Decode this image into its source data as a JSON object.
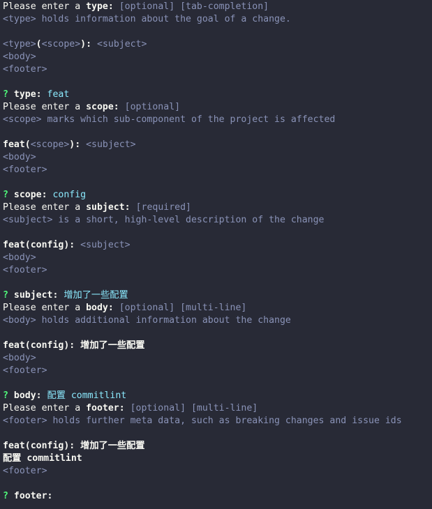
{
  "theme": {
    "background": "#282a36",
    "text": "#f8f8f2",
    "dim": "#8a93b8",
    "answer": "#8be9fd",
    "prompt_mark": "#50fa7b"
  },
  "lines": [
    [
      {
        "s": "w",
        "t": "Please enter a "
      },
      {
        "s": "b",
        "t": "type:"
      },
      {
        "s": "d",
        "t": " [optional] [tab-completion]"
      }
    ],
    [
      {
        "s": "d",
        "t": "<type> holds information about the goal of a change."
      }
    ],
    [],
    [
      {
        "s": "d",
        "t": "<type>"
      },
      {
        "s": "b",
        "t": "("
      },
      {
        "s": "d",
        "t": "<scope>"
      },
      {
        "s": "b",
        "t": "):"
      },
      {
        "s": "d",
        "t": " <subject>"
      }
    ],
    [
      {
        "s": "d",
        "t": "<body>"
      }
    ],
    [
      {
        "s": "d",
        "t": "<footer>"
      }
    ],
    [],
    [
      {
        "s": "g",
        "t": "?"
      },
      {
        "s": "b",
        "t": " type:"
      },
      {
        "s": "c",
        "t": " feat"
      }
    ],
    [
      {
        "s": "w",
        "t": "Please enter a "
      },
      {
        "s": "b",
        "t": "scope:"
      },
      {
        "s": "d",
        "t": " [optional]"
      }
    ],
    [
      {
        "s": "d",
        "t": "<scope> marks which sub-component of the project is affected"
      }
    ],
    [],
    [
      {
        "s": "b",
        "t": "feat("
      },
      {
        "s": "d",
        "t": "<scope>"
      },
      {
        "s": "b",
        "t": "):"
      },
      {
        "s": "d",
        "t": " <subject>"
      }
    ],
    [
      {
        "s": "d",
        "t": "<body>"
      }
    ],
    [
      {
        "s": "d",
        "t": "<footer>"
      }
    ],
    [],
    [
      {
        "s": "g",
        "t": "?"
      },
      {
        "s": "b",
        "t": " scope:"
      },
      {
        "s": "c",
        "t": " config"
      }
    ],
    [
      {
        "s": "w",
        "t": "Please enter a "
      },
      {
        "s": "b",
        "t": "subject:"
      },
      {
        "s": "d",
        "t": " [required]"
      }
    ],
    [
      {
        "s": "d",
        "t": "<subject> is a short, high-level description of the change"
      }
    ],
    [],
    [
      {
        "s": "b",
        "t": "feat(config):"
      },
      {
        "s": "d",
        "t": " <subject>"
      }
    ],
    [
      {
        "s": "d",
        "t": "<body>"
      }
    ],
    [
      {
        "s": "d",
        "t": "<footer>"
      }
    ],
    [],
    [
      {
        "s": "g",
        "t": "?"
      },
      {
        "s": "b",
        "t": " subject:"
      },
      {
        "s": "c",
        "t": " 增加了一些配置"
      }
    ],
    [
      {
        "s": "w",
        "t": "Please enter a "
      },
      {
        "s": "b",
        "t": "body:"
      },
      {
        "s": "d",
        "t": " [optional] [multi-line]"
      }
    ],
    [
      {
        "s": "d",
        "t": "<body> holds additional information about the change"
      }
    ],
    [],
    [
      {
        "s": "b",
        "t": "feat(config): 增加了一些配置"
      }
    ],
    [
      {
        "s": "d",
        "t": "<body>"
      }
    ],
    [
      {
        "s": "d",
        "t": "<footer>"
      }
    ],
    [],
    [
      {
        "s": "g",
        "t": "?"
      },
      {
        "s": "b",
        "t": " body:"
      },
      {
        "s": "c",
        "t": " 配置 commitlint"
      }
    ],
    [
      {
        "s": "w",
        "t": "Please enter a "
      },
      {
        "s": "b",
        "t": "footer:"
      },
      {
        "s": "d",
        "t": " [optional] [multi-line]"
      }
    ],
    [
      {
        "s": "d",
        "t": "<footer> holds further meta data, such as breaking changes and issue ids"
      }
    ],
    [],
    [
      {
        "s": "b",
        "t": "feat(config): 增加了一些配置"
      }
    ],
    [
      {
        "s": "b",
        "t": "配置 commitlint"
      }
    ],
    [
      {
        "s": "d",
        "t": "<footer>"
      }
    ],
    [],
    [
      {
        "s": "g",
        "t": "?"
      },
      {
        "s": "b",
        "t": " footer:"
      }
    ]
  ]
}
